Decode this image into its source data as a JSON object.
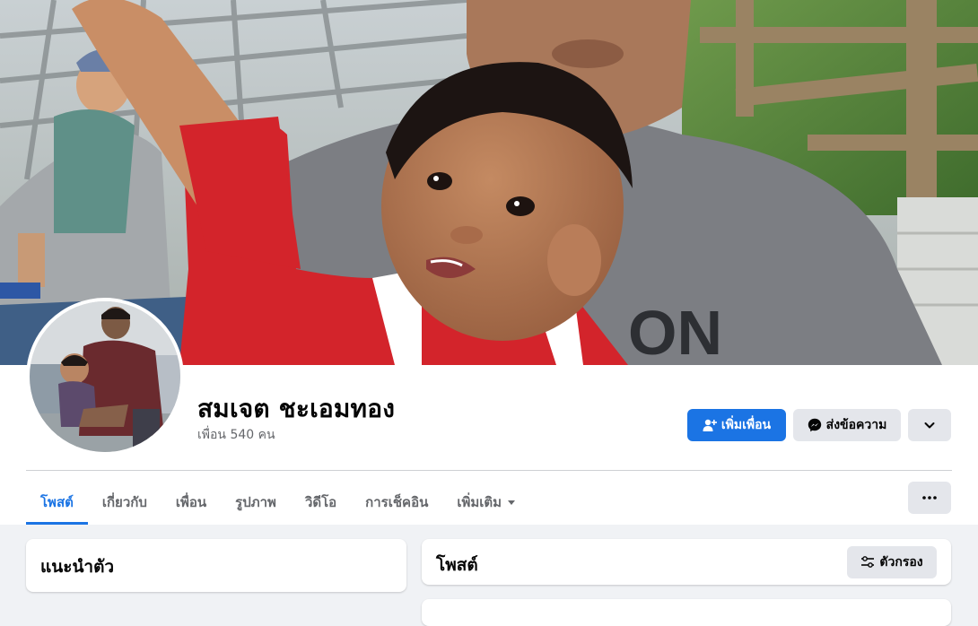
{
  "profile": {
    "name": "สมเจต ชะเอมทอง",
    "friends_count": "เพื่อน 540 คน"
  },
  "actions": {
    "add_friend": "เพิ่มเพื่อน",
    "message": "ส่งข้อความ"
  },
  "tabs": [
    {
      "label": "โพสต์",
      "active": true
    },
    {
      "label": "เกี่ยวกับ"
    },
    {
      "label": "เพื่อน"
    },
    {
      "label": "รูปภาพ"
    },
    {
      "label": "วิดีโอ"
    },
    {
      "label": "การเช็คอิน"
    },
    {
      "label": "เพิ่มเติม"
    }
  ],
  "intro": {
    "title": "แนะนำตัว"
  },
  "posts": {
    "title": "โพสต์",
    "filter_label": "ตัวกรอง"
  },
  "colors": {
    "accent": "#1b74e4",
    "page_bg": "#f0f2f5",
    "button_gray": "#e4e6eb"
  }
}
